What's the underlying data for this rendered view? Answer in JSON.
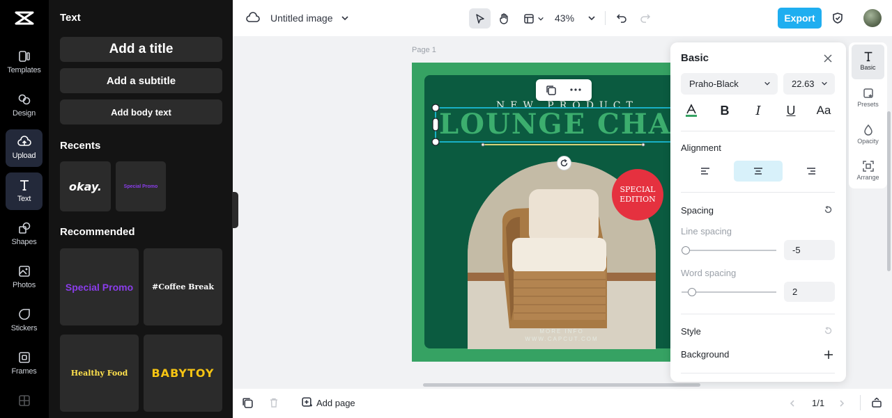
{
  "rail": {
    "items": [
      {
        "label": "Templates",
        "icon": "templates-icon"
      },
      {
        "label": "Design",
        "icon": "design-icon"
      },
      {
        "label": "Upload",
        "icon": "upload-icon"
      },
      {
        "label": "Text",
        "icon": "text-icon"
      },
      {
        "label": "Shapes",
        "icon": "shapes-icon"
      },
      {
        "label": "Photos",
        "icon": "photos-icon"
      },
      {
        "label": "Stickers",
        "icon": "stickers-icon"
      },
      {
        "label": "Frames",
        "icon": "frames-icon"
      }
    ]
  },
  "panel": {
    "title": "Text",
    "add_title": "Add a title",
    "add_subtitle": "Add a subtitle",
    "add_body": "Add body text",
    "recents_heading": "Recents",
    "recents": [
      "okay.",
      "Special Promo"
    ],
    "recommended_heading": "Recommended",
    "recommended": [
      "Special Promo",
      "#Coffee Break",
      "Healthy Food",
      "BABYTOY"
    ]
  },
  "topbar": {
    "doc_title": "Untitled image",
    "zoom": "43%",
    "export_label": "Export"
  },
  "canvas": {
    "page_label": "Page 1",
    "new_product": "NEW PRODUCT",
    "headline": "LOUNGE CHAIR",
    "badge_line1": "SPECIAL",
    "badge_line2": "EDITION",
    "more_info": "MORE INFO",
    "website": "WWW.CAPCUT.COM"
  },
  "bottombar": {
    "add_page_label": "Add page",
    "pagination": "1/1"
  },
  "props": {
    "title": "Basic",
    "font_name": "Praho-Black",
    "font_size": "22.63",
    "alignment_label": "Alignment",
    "spacing_label": "Spacing",
    "line_spacing_label": "Line spacing",
    "line_spacing_value": "-5",
    "word_spacing_label": "Word spacing",
    "word_spacing_value": "2",
    "style_label": "Style",
    "background_label": "Background"
  },
  "minirail": {
    "items": [
      "Basic",
      "Presets",
      "Opacity",
      "Arrange"
    ]
  },
  "colors": {
    "accent": "#1faef0",
    "design_bg": "#36a263",
    "design_inner": "#0b5b40",
    "badge": "#e5313f",
    "selection": "#19b1c6"
  }
}
